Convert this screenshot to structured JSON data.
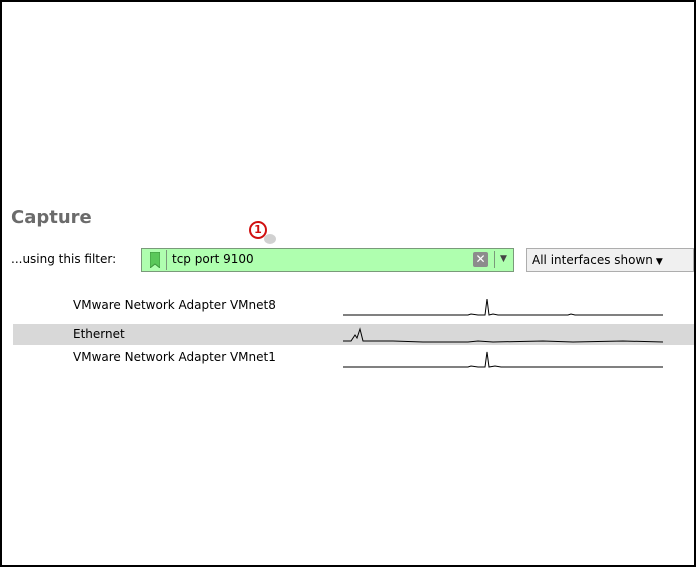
{
  "capture": {
    "title": "Capture",
    "filter_label": "...using this filter:",
    "filter_value": "tcp port 9100",
    "filter_bg_color": "#afffaf",
    "bookmark_icon": "bookmark-icon",
    "clear_icon": "clear-x-icon",
    "dropdown_icon": "chevron-down-icon",
    "interfaces_label": "All interfaces shown",
    "annotation_number": "1",
    "annotation_color": "#d01010"
  },
  "interfaces": [
    {
      "name": "VMware Network Adapter VMnet8",
      "selected": false
    },
    {
      "name": "Ethernet",
      "selected": true
    },
    {
      "name": "VMware Network Adapter VMnet1",
      "selected": false
    }
  ]
}
